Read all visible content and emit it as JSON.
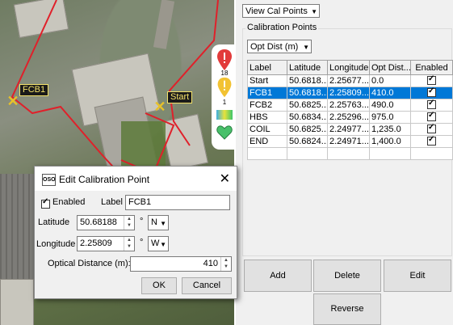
{
  "map": {
    "markers": [
      {
        "label": "FCB1"
      },
      {
        "label": "Start"
      }
    ]
  },
  "sidebar": {
    "alert_count_red": "18",
    "alert_count_yellow": "1",
    "icons": [
      "error-marker-icon",
      "warning-marker-icon",
      "layers-icon",
      "heart-icon"
    ]
  },
  "panel": {
    "view_select": "View Cal Points",
    "group_title": "Calibration Points",
    "sort_select": "Opt Dist (m)",
    "table": {
      "headers": [
        "Label",
        "Latitude",
        "Longitude",
        "Opt Dist...",
        "Enabled"
      ],
      "rows": [
        {
          "label": "Start",
          "lat": "50.6818...",
          "lon": "2.25677...",
          "dist": "0.0"
        },
        {
          "label": "FCB1",
          "lat": "50.6818...",
          "lon": "2.25809...",
          "dist": "410.0"
        },
        {
          "label": "FCB2",
          "lat": "50.6825...",
          "lon": "2.25763...",
          "dist": "490.0"
        },
        {
          "label": "HBS",
          "lat": "50.6834...",
          "lon": "2.25296...",
          "dist": "975.0"
        },
        {
          "label": "COIL",
          "lat": "50.6825...",
          "lon": "2.24977...",
          "dist": "1,235.0"
        },
        {
          "label": "END",
          "lat": "50.6824...",
          "lon": "2.24971...",
          "dist": "1,400.0"
        }
      ],
      "selected_index": 1
    },
    "buttons": {
      "add": "Add",
      "delete": "Delete",
      "edit": "Edit",
      "reverse": "Reverse"
    }
  },
  "dialog": {
    "logo": "OSO",
    "title": "Edit Calibration Point",
    "enabled_label": "Enabled",
    "label_label": "Label",
    "label_value": "FCB1",
    "latitude_label": "Latitude",
    "latitude_value": "50.68188",
    "latitude_unit": "°",
    "latitude_hemi": "N",
    "longitude_label": "Longitude",
    "longitude_value": "2.25809",
    "longitude_unit": "°",
    "longitude_hemi": "W",
    "optical_label": "Optical Distance (m):",
    "optical_value": "410",
    "ok": "OK",
    "cancel": "Cancel"
  }
}
